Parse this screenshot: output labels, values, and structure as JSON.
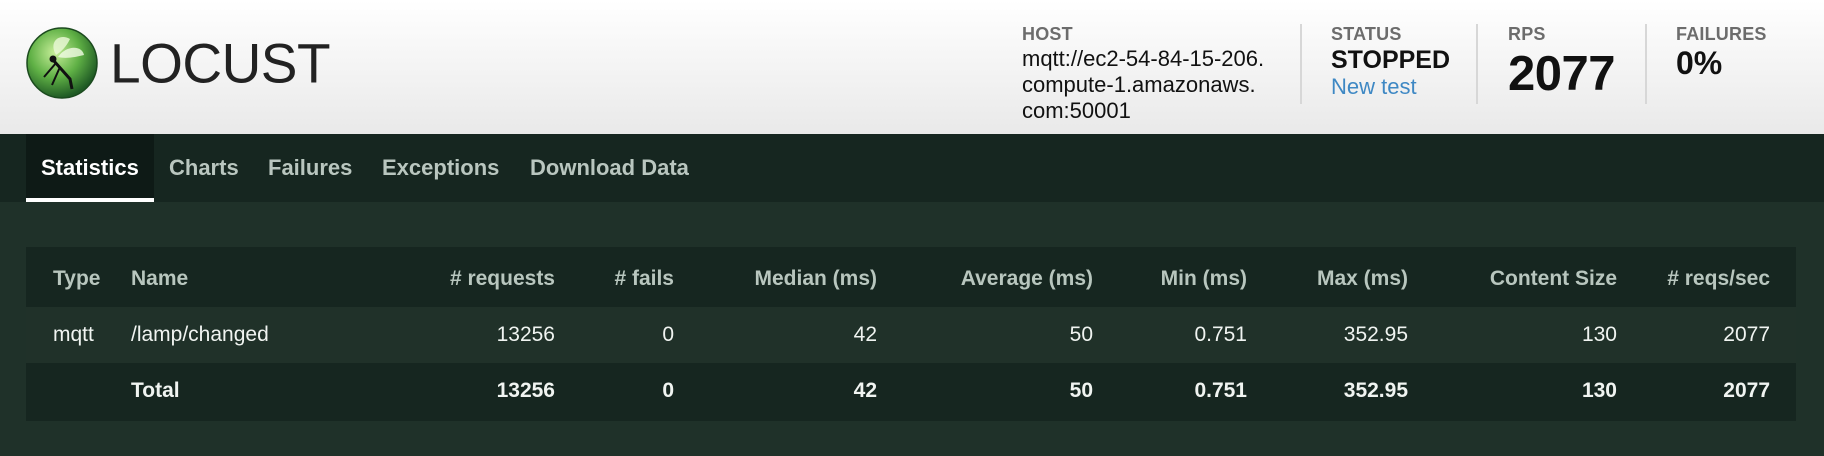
{
  "header": {
    "logo_text": "LOCUST",
    "host": {
      "label": "HOST",
      "value": "mqtt://ec2-54-84-15-206.compute-1.amazonaws.com:50001"
    },
    "status": {
      "label": "STATUS",
      "value": "STOPPED",
      "link": "New test"
    },
    "rps": {
      "label": "RPS",
      "value": "2077"
    },
    "failures": {
      "label": "FAILURES",
      "value": "0%"
    }
  },
  "nav": {
    "tabs": [
      {
        "label": "Statistics",
        "active": true
      },
      {
        "label": "Charts"
      },
      {
        "label": "Failures"
      },
      {
        "label": "Exceptions"
      },
      {
        "label": "Download Data"
      }
    ]
  },
  "table": {
    "headers": [
      "Type",
      "Name",
      "# requests",
      "# fails",
      "Median (ms)",
      "Average (ms)",
      "Min (ms)",
      "Max (ms)",
      "Content Size",
      "# reqs/sec"
    ],
    "rows": [
      [
        "mqtt",
        "/lamp/changed",
        "13256",
        "0",
        "42",
        "50",
        "0.751",
        "352.95",
        "130",
        "2077"
      ]
    ],
    "total": [
      "",
      "Total",
      "13256",
      "0",
      "42",
      "50",
      "0.751",
      "352.95",
      "130",
      "2077"
    ]
  },
  "colors": {
    "page_bg": "#1f3129",
    "nav_bg": "#162620",
    "link": "#3e88c4"
  }
}
